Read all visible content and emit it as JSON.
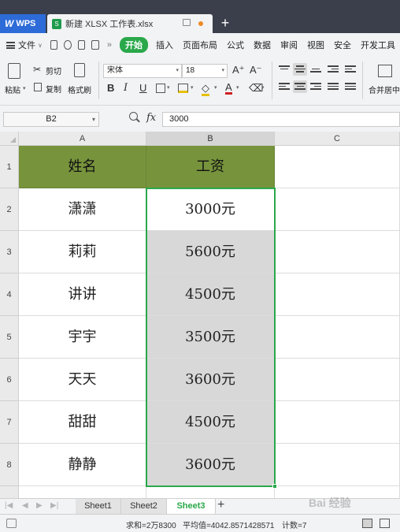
{
  "titlebar": {
    "app_tab": "WPS",
    "doc_tab": "新建 XLSX 工作表.xlsx",
    "new_tab_symbol": "+"
  },
  "menubar": {
    "file": "文件",
    "more": "»",
    "start": "开始",
    "items": [
      "插入",
      "页面布局",
      "公式",
      "数据",
      "审阅",
      "视图",
      "安全",
      "开发工具"
    ]
  },
  "ribbon": {
    "paste": "粘贴",
    "cut": "剪切",
    "copy": "复制",
    "format_painter": "格式刷",
    "font_name": "宋体",
    "font_size": "18",
    "grow_font": "A⁺",
    "shrink_font": "A⁻",
    "bold": "B",
    "italic": "I",
    "underline": "U",
    "merge_center": "合并居中"
  },
  "formula_bar": {
    "name_box": "B2",
    "fx_label": "fx",
    "value": "3000"
  },
  "sheet": {
    "columns": [
      "A",
      "B",
      "C"
    ],
    "selected_column": "B",
    "row_numbers": [
      "1",
      "2",
      "3",
      "4",
      "5",
      "6",
      "7",
      "8"
    ],
    "header": {
      "name": "姓名",
      "salary": "工资"
    },
    "rows": [
      {
        "name": "潇潇",
        "salary": "3000元"
      },
      {
        "name": "莉莉",
        "salary": "5600元"
      },
      {
        "name": "讲讲",
        "salary": "4500元"
      },
      {
        "name": "宇宇",
        "salary": "3500元"
      },
      {
        "name": "天天",
        "salary": "3600元"
      },
      {
        "name": "甜甜",
        "salary": "4500元"
      },
      {
        "name": "静静",
        "salary": "3600元"
      }
    ],
    "header_fill_color": "#77933c",
    "selection_color": "#2aa84a"
  },
  "sheet_tabs": {
    "tabs": [
      "Sheet1",
      "Sheet2",
      "Sheet3"
    ],
    "active": "Sheet3",
    "add_symbol": "+"
  },
  "watermark": "Bai 经验",
  "status_bar": {
    "sum": "求和=2万8300",
    "average": "平均值=4042.8571428571",
    "count": "计数=7"
  }
}
